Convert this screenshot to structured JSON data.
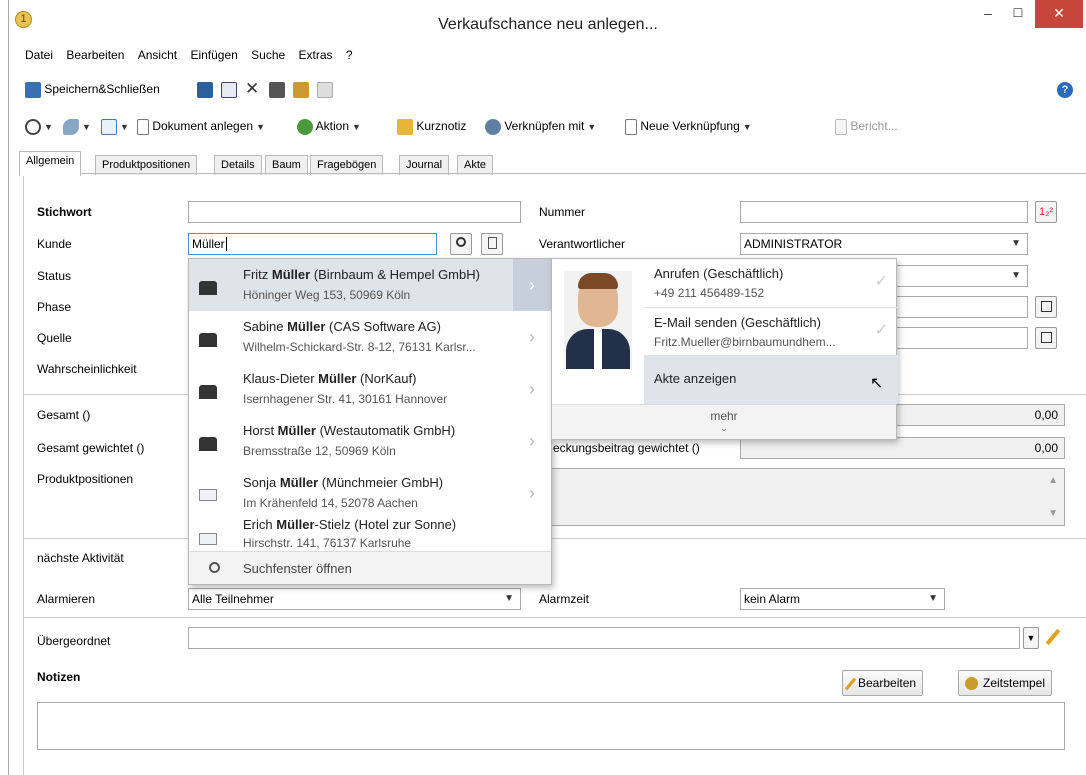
{
  "window": {
    "title": "Verkaufschance neu anlegen...",
    "minimize": "–",
    "maximize": "☐",
    "close": "✕"
  },
  "menu": [
    "Datei",
    "Bearbeiten",
    "Ansicht",
    "Einfügen",
    "Suche",
    "Extras",
    "?"
  ],
  "toolbar1": {
    "save_close": "Speichern&Schließen"
  },
  "toolbar2": {
    "create_document": "Dokument anlegen",
    "action": "Aktion",
    "short_note": "Kurznotiz",
    "link_with": "Verknüpfen mit",
    "new_link": "Neue Verknüpfung",
    "report": "Bericht..."
  },
  "tabs": [
    "Allgemein",
    "Produktpositionen",
    "Details",
    "Baum",
    "Fragebögen",
    "Journal",
    "Akte"
  ],
  "form": {
    "stichwort_label": "Stichwort",
    "kunde_label": "Kunde",
    "kunde_value": "Müller",
    "status_label": "Status",
    "phase_label": "Phase",
    "quelle_label": "Quelle",
    "wahrscheinlichkeit_label": "Wahrscheinlichkeit",
    "nummer_label": "Nummer",
    "nummer_btn": "1₂²",
    "verantwortlicher_label": "Verantwortlicher",
    "verantwortlicher_value": "ADMINISTRATOR",
    "gesamt_label": "Gesamt ()",
    "gesamt_value": "0,00",
    "gesamt_gewichtet_label": "Gesamt gewichtet ()",
    "deckung_label": "eckungsbeitrag gewichtet ()",
    "deckung_value": "0,00",
    "produktpositionen_label": "Produktpositionen",
    "naechste_aktivitaet_label": "nächste Aktivität",
    "alarmieren_label": "Alarmieren",
    "alarmieren_value": "Alle Teilnehmer",
    "alarmzeit_label": "Alarmzeit",
    "alarmzeit_value": "kein Alarm",
    "uebergeordnet_label": "Übergeordnet",
    "notizen_label": "Notizen",
    "bearbeiten_btn": "Bearbeiten",
    "zeitstempel_btn": "Zeitstempel"
  },
  "dropdown": {
    "items": [
      {
        "pre": "Fritz ",
        "match": "Müller",
        "post": " (Birnbaum & Hempel GmbH)",
        "address": "Höninger Weg 153, 50969 Köln",
        "type": "person"
      },
      {
        "pre": "Sabine ",
        "match": "Müller",
        "post": " (CAS Software AG)",
        "address": "Wilhelm-Schickard-Str. 8-12, 76131 Karlsr...",
        "type": "person"
      },
      {
        "pre": "Klaus-Dieter ",
        "match": "Müller",
        "post": " (NorKauf)",
        "address": "Isernhagener Str. 41, 30161 Hannover",
        "type": "person"
      },
      {
        "pre": "Horst ",
        "match": "Müller",
        "post": " (Westautomatik GmbH)",
        "address": "Bremsstraße 12, 50969 Köln",
        "type": "person"
      },
      {
        "pre": "Sonja ",
        "match": "Müller",
        "post": " (Münchmeier GmbH)",
        "address": "Im Krähenfeld 14, 52078 Aachen",
        "type": "card"
      },
      {
        "pre": "Erich ",
        "match": "Müller",
        "post": "-Stielz (Hotel zur Sonne)",
        "address": "Hirschstr. 141, 76137 Karlsruhe",
        "type": "card"
      }
    ],
    "footer": "Suchfenster öffnen"
  },
  "contact_panel": {
    "call_title": "Anrufen (Geschäftlich)",
    "call_number": "+49 211 456489-152",
    "mail_title": "E-Mail senden (Geschäftlich)",
    "mail_address": "Fritz.Mueller@birnbaumundhem...",
    "show_file": "Akte anzeigen",
    "more": "mehr"
  },
  "colors": {
    "selected_row": "#dfe3ea",
    "close_button": "#c7463c",
    "help": "#2a6bbf"
  }
}
